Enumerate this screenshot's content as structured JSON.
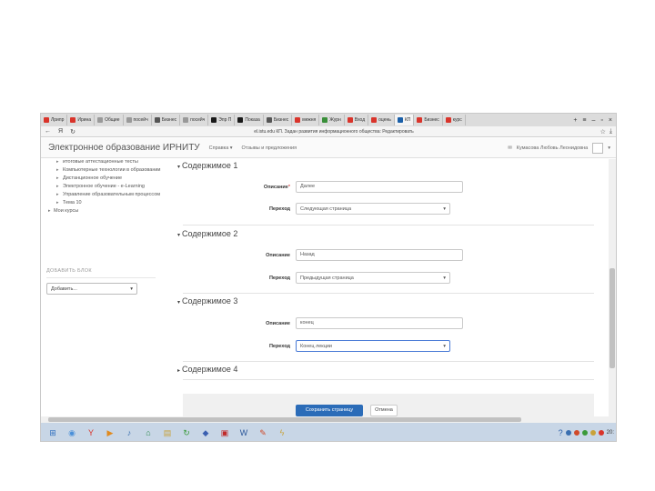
{
  "browser": {
    "tabs": [
      {
        "label": "Лрипр",
        "color": "#d9342b"
      },
      {
        "label": "Ирина",
        "color": "#d9342b"
      },
      {
        "label": "Общие",
        "color": "#999999"
      },
      {
        "label": "посейч",
        "color": "#999999"
      },
      {
        "label": "Бизнес",
        "color": "#555555"
      },
      {
        "label": "посейч",
        "color": "#999999"
      },
      {
        "label": "Эпр П",
        "color": "#1a1a1a"
      },
      {
        "label": "Показа",
        "color": "#1a1a1a"
      },
      {
        "label": "Бизнес",
        "color": "#555555"
      },
      {
        "label": "межня",
        "color": "#d9342b"
      },
      {
        "label": "Журн",
        "color": "#3a8f3a"
      },
      {
        "label": "Вход",
        "color": "#d9342b"
      },
      {
        "label": "оцень",
        "color": "#d9342b"
      },
      {
        "label": "КП",
        "color": "#1a5fa8",
        "active": true
      },
      {
        "label": "Бизнес",
        "color": "#d9342b"
      },
      {
        "label": "курс",
        "color": "#d9342b"
      }
    ],
    "window_controls": [
      "+",
      "≡",
      "–",
      "▫",
      "×"
    ],
    "url": "el.istu.edu КП. Задан развития информационного общества: Редактировать"
  },
  "header": {
    "site_name": "Электронное образование ИРНИТУ",
    "menu": [
      "Справка ▾",
      "Отзывы и предложения"
    ],
    "user_name": "Кумасова Любовь Леонидовна"
  },
  "nav": {
    "items": [
      {
        "label": "итоговые аттестационные тесты",
        "level": 1
      },
      {
        "label": "Компьютерные технологии в образовании",
        "level": 1
      },
      {
        "label": "Дистанционное обучение",
        "level": 1
      },
      {
        "label": "Электронное обучение - e-Learning",
        "level": 1
      },
      {
        "label": "Управление образовательным процессом",
        "level": 1
      },
      {
        "label": "Тема 10",
        "level": 1
      },
      {
        "label": "Мои курсы",
        "level": 0
      }
    ]
  },
  "add_block": {
    "title": "ДОБАВИТЬ БЛОК",
    "select_value": "Добавить..."
  },
  "sections": [
    {
      "title": "Содержимое 1",
      "expanded": true,
      "desc_label": "Описание",
      "desc_required": true,
      "desc_value": "Далее",
      "jump_label": "Переход",
      "jump_value": "Следующая страница"
    },
    {
      "title": "Содержимое 2",
      "expanded": true,
      "desc_label": "Описание",
      "desc_required": false,
      "desc_value": "Назад",
      "jump_label": "Переход",
      "jump_value": "Предыдущая страница"
    },
    {
      "title": "Содержимое 3",
      "expanded": true,
      "desc_label": "Описание",
      "desc_required": false,
      "desc_value": "конец",
      "jump_label": "Переход",
      "jump_value": "Конец лекции"
    },
    {
      "title": "Содержимое 4",
      "expanded": false
    }
  ],
  "buttons": {
    "save": "Сохранить страницу",
    "cancel": "Отмена"
  },
  "taskbar": {
    "icons": [
      {
        "name": "start-orb-icon",
        "glyph": "⊞",
        "color": "#2f6fbf"
      },
      {
        "name": "browser-icon",
        "glyph": "◉",
        "color": "#4a90d9"
      },
      {
        "name": "yandex-icon",
        "glyph": "Y",
        "color": "#d9342b"
      },
      {
        "name": "media-icon",
        "glyph": "▶",
        "color": "#e08a1e"
      },
      {
        "name": "sound-icon",
        "glyph": "♪",
        "color": "#3a6fb0"
      },
      {
        "name": "network-icon",
        "glyph": "⌂",
        "color": "#2a8a4a"
      },
      {
        "name": "folder-icon",
        "glyph": "▤",
        "color": "#c9a23a"
      },
      {
        "name": "refresh-icon",
        "glyph": "↻",
        "color": "#3a9a3a"
      },
      {
        "name": "app-icon",
        "glyph": "◆",
        "color": "#3a5fb0"
      },
      {
        "name": "pdf-icon",
        "glyph": "▣",
        "color": "#c02a2a"
      },
      {
        "name": "word-icon",
        "glyph": "W",
        "color": "#2b579a"
      },
      {
        "name": "paint-icon",
        "glyph": "✎",
        "color": "#d04a2a"
      },
      {
        "name": "flash-icon",
        "glyph": "ϟ",
        "color": "#c9a23a"
      }
    ],
    "clock": "20:"
  }
}
